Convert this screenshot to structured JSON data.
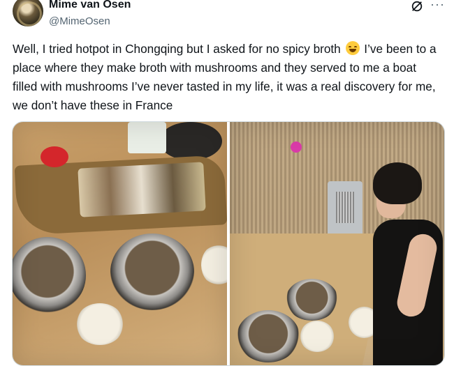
{
  "author": {
    "name": "Mime van Osen",
    "handle": "@MimeOsen"
  },
  "icons": {
    "grok": "grok-icon",
    "more": "more-icon",
    "emoji": "laughing-tears-emoji"
  },
  "tweet": {
    "text_before_emoji": "Well, I tried hotpot in Chongqing but I asked for no spicy broth ",
    "text_after_emoji": " I’ve been to a place where they make broth with mushrooms and they served to me a boat filled with mushrooms I’ve never tasted in my life, it was a real discovery for me, we don’t have these in France"
  },
  "media": {
    "count": 2
  }
}
